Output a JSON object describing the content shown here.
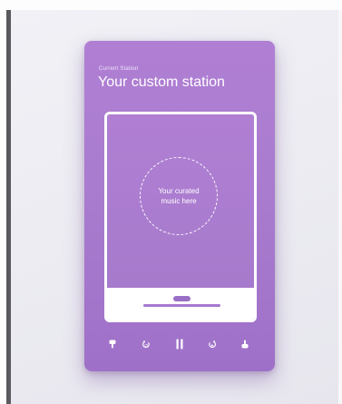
{
  "station": {
    "eyebrow": "Current Station",
    "title": "Your custom station",
    "placeholder_line1": "Your curated",
    "placeholder_line2": "music here"
  },
  "controls": [
    {
      "name": "thumbs-down",
      "icon": "thumbs-down-icon"
    },
    {
      "name": "rewind",
      "icon": "rewind-icon"
    },
    {
      "name": "pause",
      "icon": "pause-icon"
    },
    {
      "name": "skip",
      "icon": "skip-icon"
    },
    {
      "name": "thumbs-up",
      "icon": "thumbs-up-icon"
    }
  ],
  "colors": {
    "card": "#a97ccf",
    "accent": "#9a6fc6",
    "foreground": "#ffffff"
  }
}
